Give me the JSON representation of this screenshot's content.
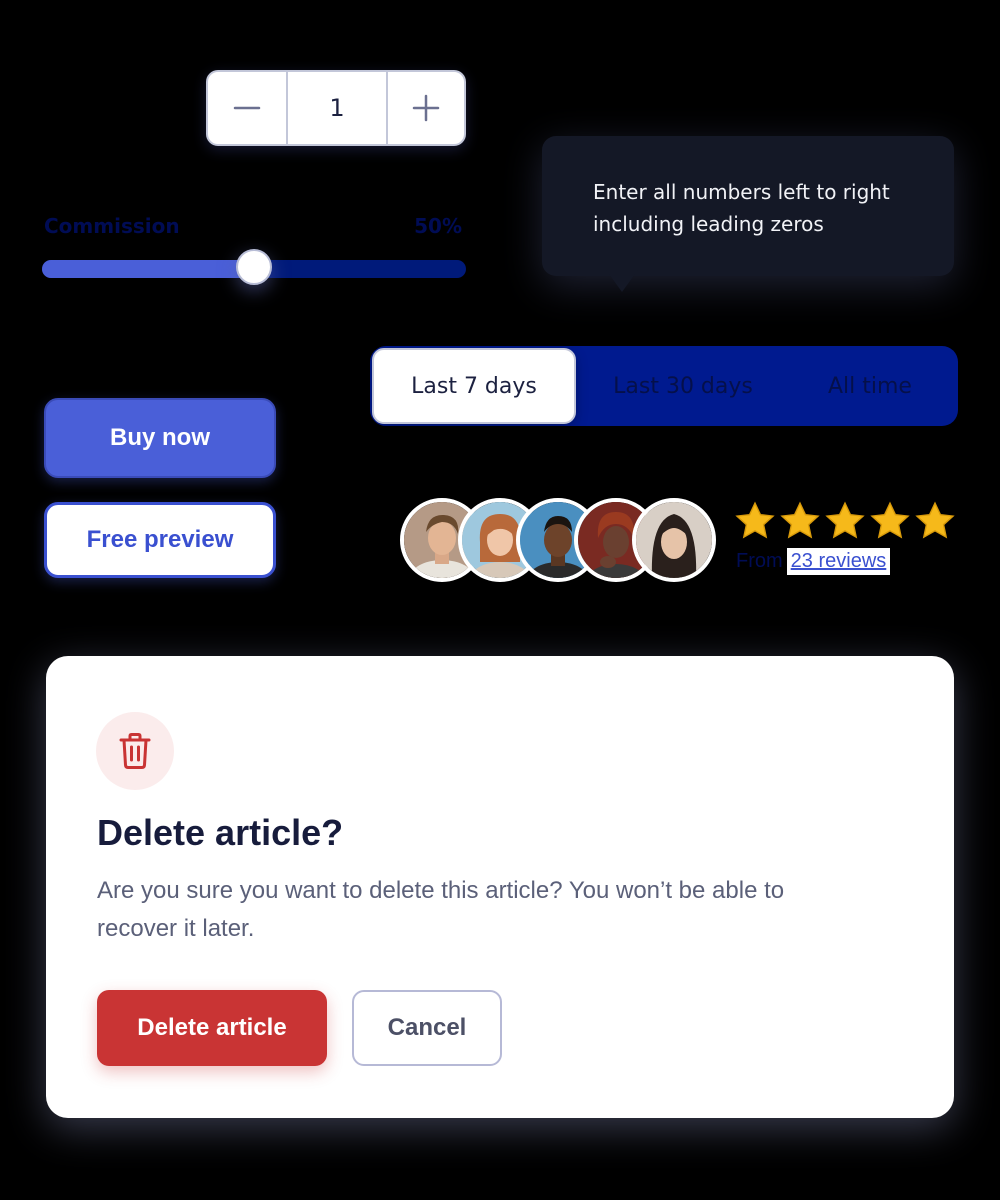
{
  "stepper": {
    "value": "1",
    "minus_icon": "minus-icon",
    "plus_icon": "plus-icon"
  },
  "slider": {
    "label": "Commission",
    "value_text": "50%",
    "value": 0.5,
    "fill_color": "#4a5fd8",
    "track_color": "#001a7a"
  },
  "tooltip": {
    "line1": "Enter all numbers left to right",
    "line2": "including leading zeros"
  },
  "range_selector": {
    "options": [
      {
        "label": "Last 7 days",
        "selected": true
      },
      {
        "label": "Last 30 days",
        "selected": false
      },
      {
        "label": "All time",
        "selected": false
      }
    ]
  },
  "buttons": {
    "buy_now": "Buy now",
    "free_preview": "Free preview"
  },
  "rating": {
    "stars": 5,
    "max": 5,
    "star_color": "#f6b91a",
    "from_text": "From",
    "reviews_text": "23 reviews"
  },
  "dialog": {
    "icon": "trash-icon",
    "title": "Delete article?",
    "body": "Are you sure you want to delete this article? You won’t be able to recover it later.",
    "confirm_label": "Delete article",
    "cancel_label": "Cancel",
    "danger_color": "#c93434"
  }
}
